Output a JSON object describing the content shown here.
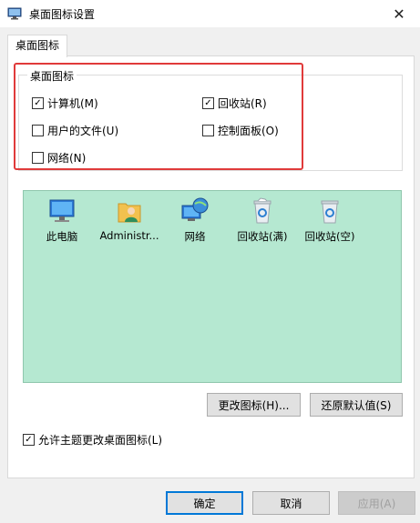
{
  "window": {
    "title": "桌面图标设置",
    "close_glyph": "✕"
  },
  "tab": {
    "label": "桌面图标"
  },
  "group": {
    "title": "桌面图标",
    "options": [
      {
        "label": "计算机(M)",
        "checked": true
      },
      {
        "label": "回收站(R)",
        "checked": true
      },
      {
        "label": "用户的文件(U)",
        "checked": false
      },
      {
        "label": "控制面板(O)",
        "checked": false
      },
      {
        "label": "网络(N)",
        "checked": false
      }
    ]
  },
  "icons": [
    {
      "label": "此电脑",
      "icon": "computer-icon"
    },
    {
      "label": "Administr...",
      "icon": "user-folder-icon"
    },
    {
      "label": "网络",
      "icon": "network-icon"
    },
    {
      "label": "回收站(满)",
      "icon": "recycle-bin-full-icon"
    },
    {
      "label": "回收站(空)",
      "icon": "recycle-bin-empty-icon"
    }
  ],
  "buttons": {
    "change_icon": "更改图标(H)...",
    "restore_default": "还原默认值(S)",
    "ok": "确定",
    "cancel": "取消",
    "apply": "应用(A)"
  },
  "theme_option": {
    "label": "允许主题更改桌面图标(L)",
    "checked": true
  },
  "colors": {
    "highlight": "#e03a3a",
    "icon_area": "#b5e8d1",
    "default_button_border": "#0078d7"
  }
}
